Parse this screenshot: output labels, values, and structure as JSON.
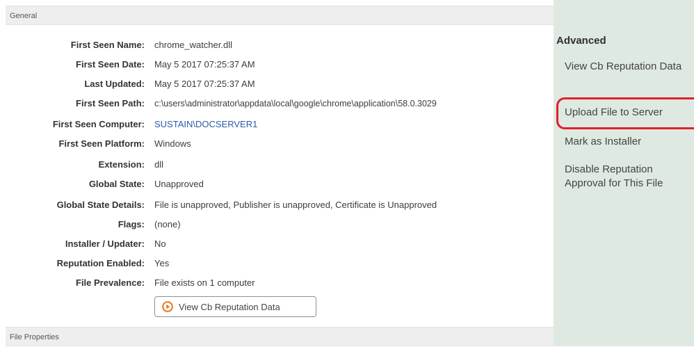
{
  "general": {
    "header": "General",
    "properties": [
      {
        "label": "First Seen Name:",
        "value": "chrome_watcher.dll"
      },
      {
        "label": "First Seen Date:",
        "value": "May 5 2017 07:25:37 AM"
      },
      {
        "label": "Last Updated:",
        "value": "May 5 2017 07:25:37 AM"
      },
      {
        "label": "First Seen Path:",
        "value": "c:\\users\\administrator\\appdata\\local\\google\\chrome\\application\\58.0.3029"
      },
      {
        "label": "First Seen Computer:",
        "value": "SUSTAIN\\DOCSERVER1"
      },
      {
        "label": "First Seen Platform:",
        "value": "Windows"
      },
      {
        "label": "Extension:",
        "value": "dll"
      },
      {
        "label": "Global State:",
        "value": "Unapproved"
      },
      {
        "label": "Global State Details:",
        "value": "File is unapproved, Publisher is unapproved, Certificate is Unapproved"
      },
      {
        "label": "Flags:",
        "value": "(none)"
      },
      {
        "label": "Installer / Updater:",
        "value": "No"
      },
      {
        "label": "Reputation Enabled:",
        "value": "Yes"
      },
      {
        "label": "File Prevalence:",
        "value": "File exists on 1 computer"
      }
    ],
    "reputation_button": {
      "label": "View Cb Reputation Data",
      "icon": "play-circle-icon"
    }
  },
  "file_properties": {
    "header": "File Properties"
  },
  "advanced": {
    "title": "Advanced",
    "items": [
      {
        "label": "View Cb Reputation Data"
      },
      {
        "label": "Upload File to Server",
        "highlighted": true
      },
      {
        "label": "Mark as Installer"
      },
      {
        "label": "Disable Reputation Approval for This File"
      }
    ]
  },
  "colors": {
    "sidebar_bg": "#dee9e2",
    "header_bg": "#eeeeee",
    "link": "#2a5ca8",
    "highlight": "#e0202a",
    "icon_accent": "#e8751a"
  }
}
